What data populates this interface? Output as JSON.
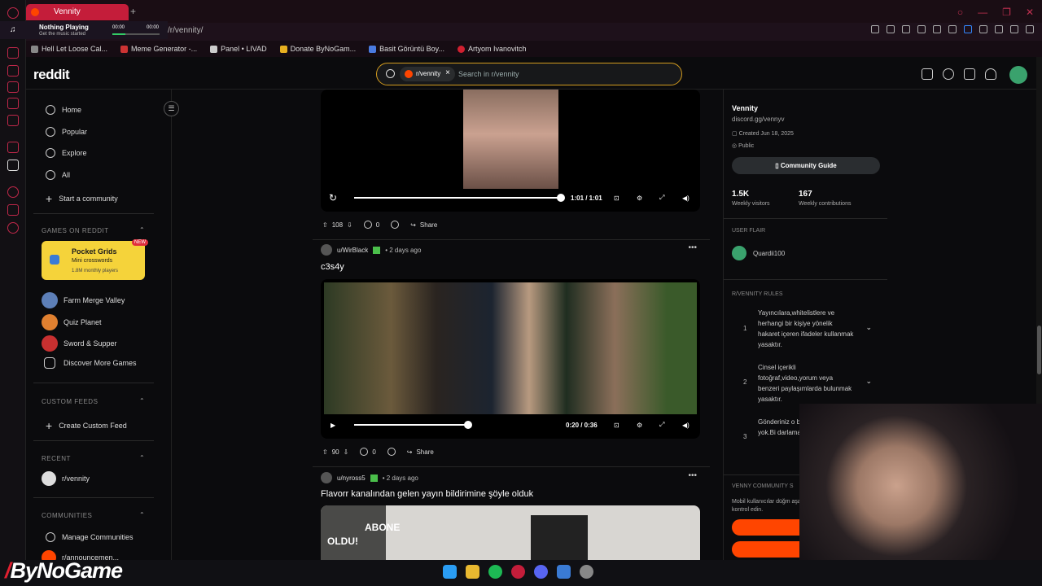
{
  "browser": {
    "tab_title": "Vennity",
    "url": "/r/vennity/",
    "music_widget": {
      "title": "Nothing Playing",
      "subtitle": "Get the music started",
      "time_start": "00:00",
      "time_end": "00:00"
    },
    "bookmarks": [
      "Hell Let Loose Cal...",
      "Meme Generator -...",
      "Panel • LIVAD",
      "Donate ByNoGam...",
      "Basit Görüntü Boy...",
      "Artyom Ivanovitch"
    ]
  },
  "header": {
    "logo": "reddit",
    "search_chip": "r/vennity",
    "search_placeholder": "Search in r/vennity"
  },
  "leftnav": {
    "main": [
      "Home",
      "Popular",
      "Explore",
      "All",
      "Start a community"
    ],
    "games_title": "GAMES ON REDDIT",
    "featured_game": {
      "name": "Pocket Grids",
      "sub": "Mini crosswords",
      "players": "1.8M monthly players",
      "badge": "NEW"
    },
    "games": [
      "Farm Merge Valley",
      "Quiz Planet",
      "Sword & Supper",
      "Discover More Games"
    ],
    "custom_title": "CUSTOM FEEDS",
    "create_feed": "Create Custom Feed",
    "recent_title": "RECENT",
    "recent_item": "r/vennity",
    "communities_title": "COMMUNITIES",
    "manage": "Manage Communities",
    "announcements": "r/announcemen..."
  },
  "posts": [
    {
      "time": "1:01 / 1:01",
      "votes": "108",
      "comments": "0",
      "share": "Share"
    },
    {
      "author": "u/WirBlack",
      "age": "• 2 days ago",
      "title": "c3s4y",
      "time": "0:20 / 0:36",
      "votes": "90",
      "comments": "0",
      "share": "Share",
      "progress": 0.55
    },
    {
      "author": "u/nyross5",
      "age": "• 2 days ago",
      "title": "Flavorr kanalından gelen yayın bildirimine şöyle olduk",
      "overlay1": "ABONE",
      "overlay2": "OLDU!"
    }
  ],
  "sidebar": {
    "name": "Vennity",
    "link": "discord.gg/vennyv",
    "created": "Created Jun 18, 2025",
    "visibility": "Public",
    "guide_button": "Community Guide",
    "stat1_value": "1.5K",
    "stat1_label": "Weekly visitors",
    "stat2_value": "167",
    "stat2_label": "Weekly contributions",
    "flair_title": "USER FLAIR",
    "flair_user": "Quardii100",
    "rules_title": "R/VENNITY RULES",
    "rules": [
      {
        "n": "1",
        "text": "Yayıncılara,whitelistlere ve herhangi bir kişiye yönelik hakaret içeren ifadeler kullanmak yasaktır."
      },
      {
        "n": "2",
        "text": "Cinsel içerikli fotoğraf,video,yorum veya benzeri paylaşımlarda bulunmak yasaktır."
      },
      {
        "n": "3",
        "text": "Gönderiniz o bu konuda y birşey yok.Bi darlamak ya"
      }
    ],
    "settings_title": "VENNY COMMUNITY S",
    "settings_text": "Mobil kullanıcılar düğm aşağıyı kontrol edin."
  },
  "watermark": "ByNoGame"
}
